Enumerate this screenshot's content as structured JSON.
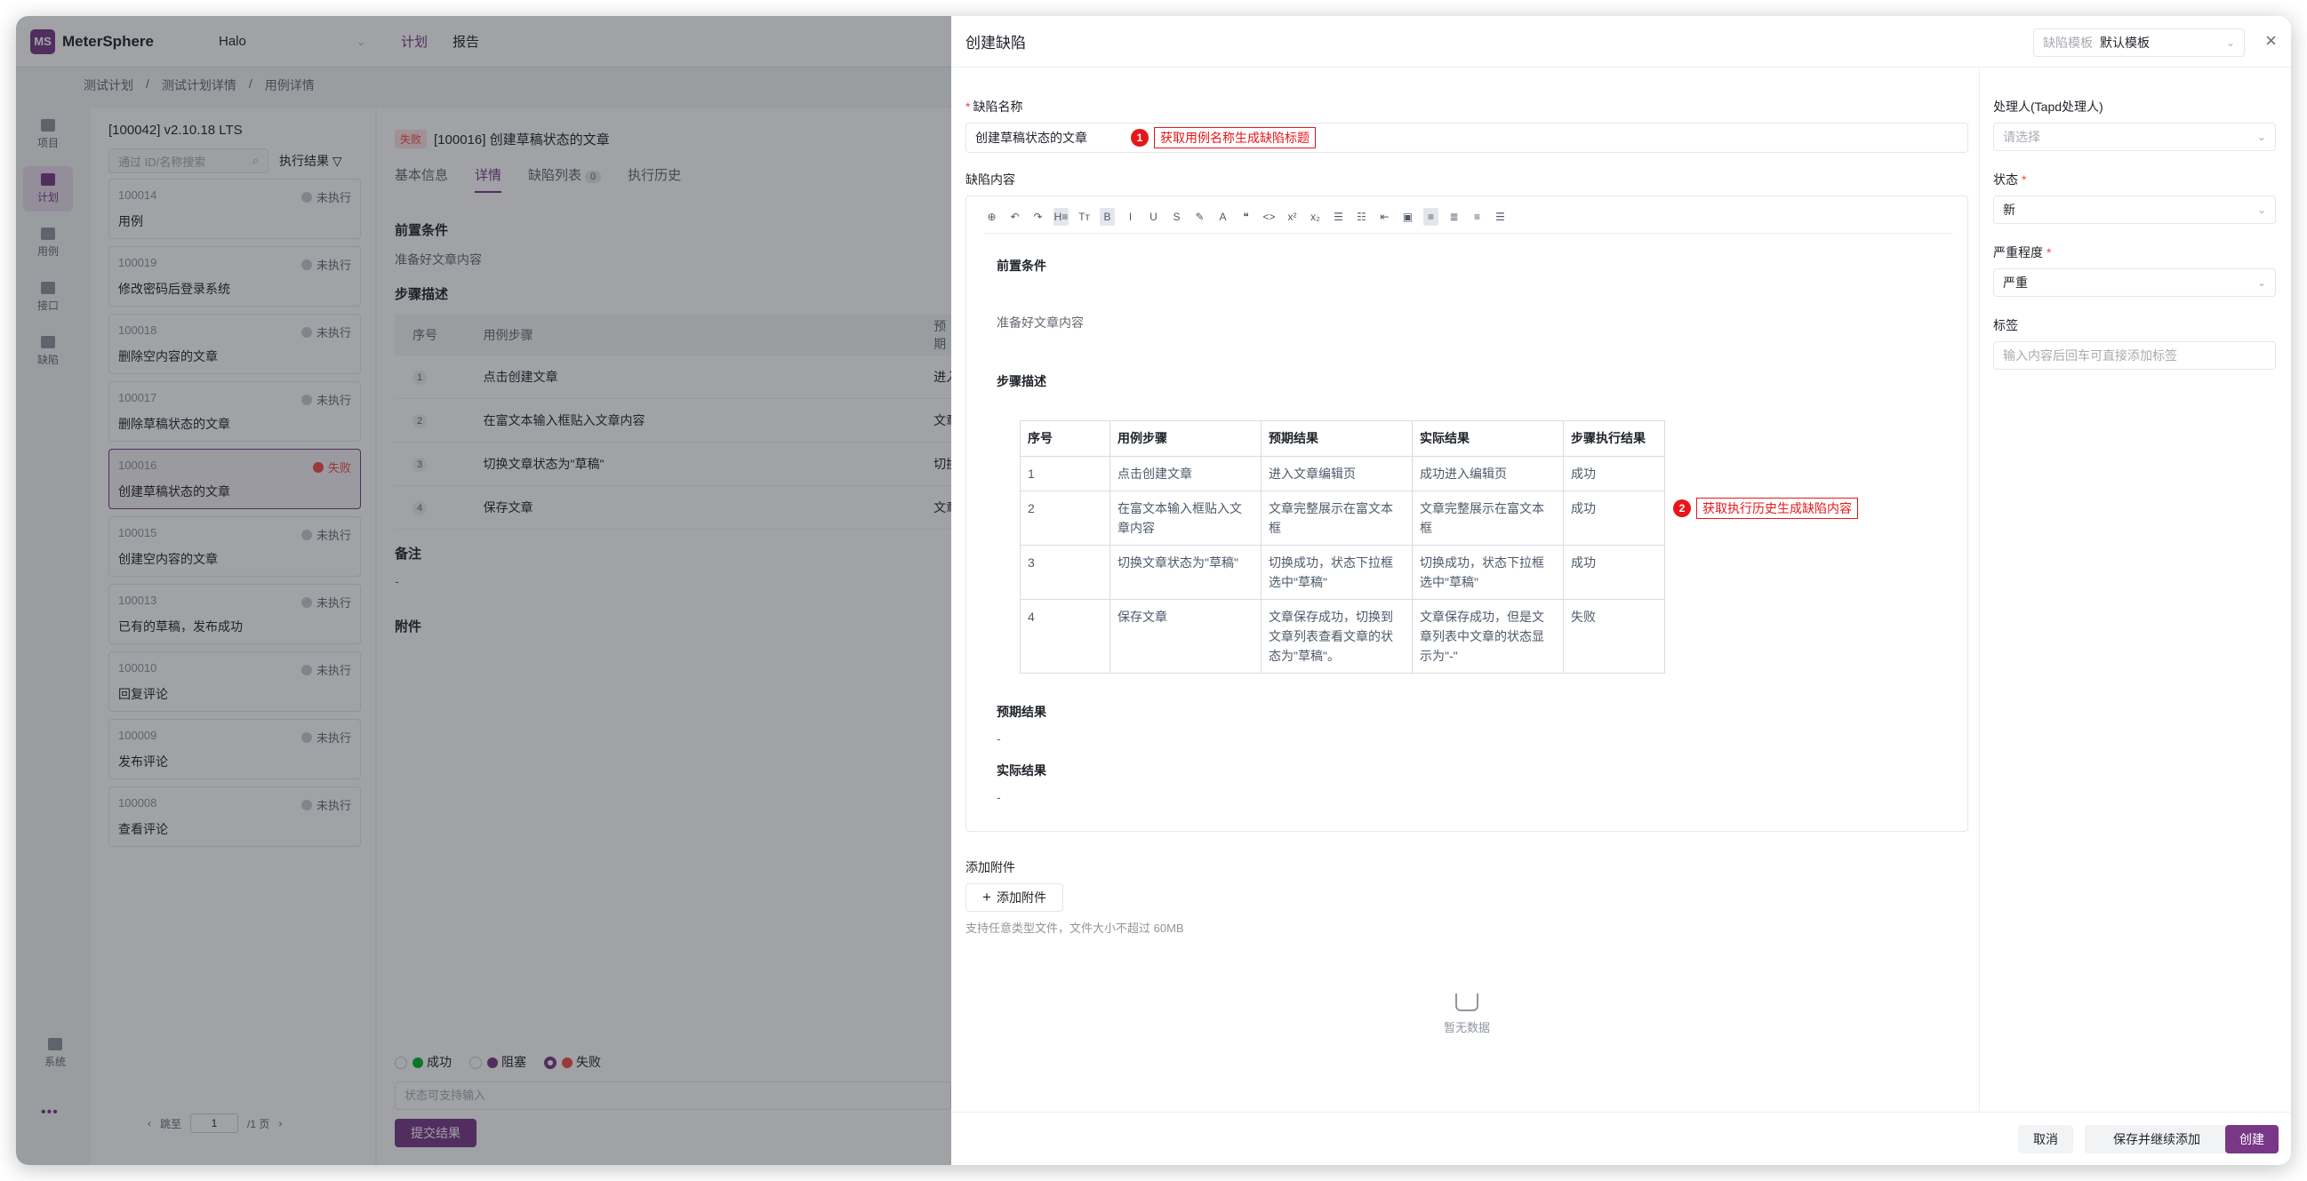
{
  "app": {
    "brand": "MeterSphere",
    "project": "Halo",
    "top_nav": [
      "计划",
      "报告"
    ],
    "breadcrumb": [
      "测试计划",
      "/",
      "测试计划详情",
      "/",
      "用例详情"
    ]
  },
  "sidenav": {
    "items": [
      "项目",
      "计划",
      "用例",
      "接口",
      "缺陷"
    ],
    "system": "系统",
    "more": "•••"
  },
  "case_list": {
    "plan_title": "[100042] v2.10.18 LTS",
    "search_placeholder": "通过 ID/名称搜索",
    "filter_label": "执行结果",
    "items": [
      {
        "id": "100014",
        "name": "用例",
        "status": "未执行"
      },
      {
        "id": "100019",
        "name": "修改密码后登录系统",
        "status": "未执行"
      },
      {
        "id": "100018",
        "name": "删除空内容的文章",
        "status": "未执行"
      },
      {
        "id": "100017",
        "name": "删除草稿状态的文章",
        "status": "未执行"
      },
      {
        "id": "100016",
        "name": "创建草稿状态的文章",
        "status": "失败"
      },
      {
        "id": "100015",
        "name": "创建空内容的文章",
        "status": "未执行"
      },
      {
        "id": "100013",
        "name": "已有的草稿，发布成功",
        "status": "未执行"
      },
      {
        "id": "100010",
        "name": "回复评论",
        "status": "未执行"
      },
      {
        "id": "100009",
        "name": "发布评论",
        "status": "未执行"
      },
      {
        "id": "100008",
        "name": "查看评论",
        "status": "未执行"
      }
    ],
    "pager": {
      "prev": "‹",
      "goto": "跳至",
      "page": "1",
      "total": "/1 页",
      "next": "›"
    }
  },
  "case_detail": {
    "tag": "失败",
    "title": "[100016] 创建草稿状态的文章",
    "tabs": [
      "基本信息",
      "详情",
      "缺陷列表",
      "执行历史"
    ],
    "bug_count": "0",
    "precondition_label": "前置条件",
    "precondition_text": "准备好文章内容",
    "steps_label": "步骤描述",
    "steps_header": [
      "序号",
      "用例步骤",
      "预期"
    ],
    "steps": [
      {
        "no": "1",
        "step": "点击创建文章",
        "expect": "进入"
      },
      {
        "no": "2",
        "step": "在富文本输入框贴入文章内容",
        "expect": "文章"
      },
      {
        "no": "3",
        "step": "切换文章状态为\"草稿\"",
        "expect": "切换"
      },
      {
        "no": "4",
        "step": "保存文章",
        "expect": "文章"
      }
    ],
    "remark_label": "备注",
    "remark_text": "-",
    "attachment_label": "附件",
    "results": [
      "成功",
      "阻塞",
      "失败"
    ],
    "comment_placeholder": "状态可支持输入",
    "submit_label": "提交结果"
  },
  "drawer": {
    "title": "创建缺陷",
    "template_label": "缺陷模板",
    "template_value": "默认模板",
    "close": "×",
    "name_label": "缺陷名称",
    "name_value": "创建草稿状态的文章",
    "content_label": "缺陷内容",
    "annotation1": {
      "num": "1",
      "text": "获取用例名称生成缺陷标题"
    },
    "annotation2": {
      "num": "2",
      "text": "获取执行历史生成缺陷内容"
    },
    "toolbar": [
      "⊕",
      "↶",
      "↷",
      "H≡",
      "Tт",
      "B",
      "I",
      "U",
      "S",
      "✎",
      "A",
      "❝",
      "<>",
      "x²",
      "x₂",
      "☰",
      "☷",
      "⇤",
      "▣",
      "≡",
      "≣",
      "≡",
      "☰"
    ],
    "editor": {
      "precondition_label": "前置条件",
      "precondition_text": "准备好文章内容",
      "steps_label": "步骤描述",
      "table_header": [
        "序号",
        "用例步骤",
        "预期结果",
        "实际结果",
        "步骤执行结果"
      ],
      "table_rows": [
        [
          "1",
          "点击创建文章",
          "进入文章编辑页",
          "成功进入编辑页",
          "成功"
        ],
        [
          "2",
          "在富文本输入框贴入文章内容",
          "文章完整展示在富文本框",
          "文章完整展示在富文本框",
          "成功"
        ],
        [
          "3",
          "切换文章状态为\"草稿\"",
          "切换成功，状态下拉框选中\"草稿\"",
          "切换成功，状态下拉框选中\"草稿\"",
          "成功"
        ],
        [
          "4",
          "保存文章",
          "文章保存成功，切换到文章列表查看文章的状态为\"草稿\"。",
          "文章保存成功，但是文章列表中文章的状态显示为\"-\"",
          "失败"
        ]
      ],
      "expected_label": "预期结果",
      "expected_text": "-",
      "actual_label": "实际结果",
      "actual_text": "-"
    },
    "attachment_label": "添加附件",
    "attachment_button": "添加附件",
    "attachment_hint": "支持任意类型文件，文件大小不超过 60MB",
    "empty_text": "暂无数据",
    "side": {
      "handler_label": "处理人(Tapd处理人)",
      "handler_placeholder": "请选择",
      "status_label": "状态",
      "status_value": "新",
      "severity_label": "严重程度",
      "severity_value": "严重",
      "tags_label": "标签",
      "tags_placeholder": "输入内容后回车可直接添加标签"
    },
    "footer": {
      "cancel": "取消",
      "save_continue": "保存并继续添加",
      "create": "创建"
    }
  },
  "colors": {
    "brand": "#783887",
    "danger": "#f54a45",
    "success": "#00b42a",
    "annotation": "#e6171a"
  }
}
